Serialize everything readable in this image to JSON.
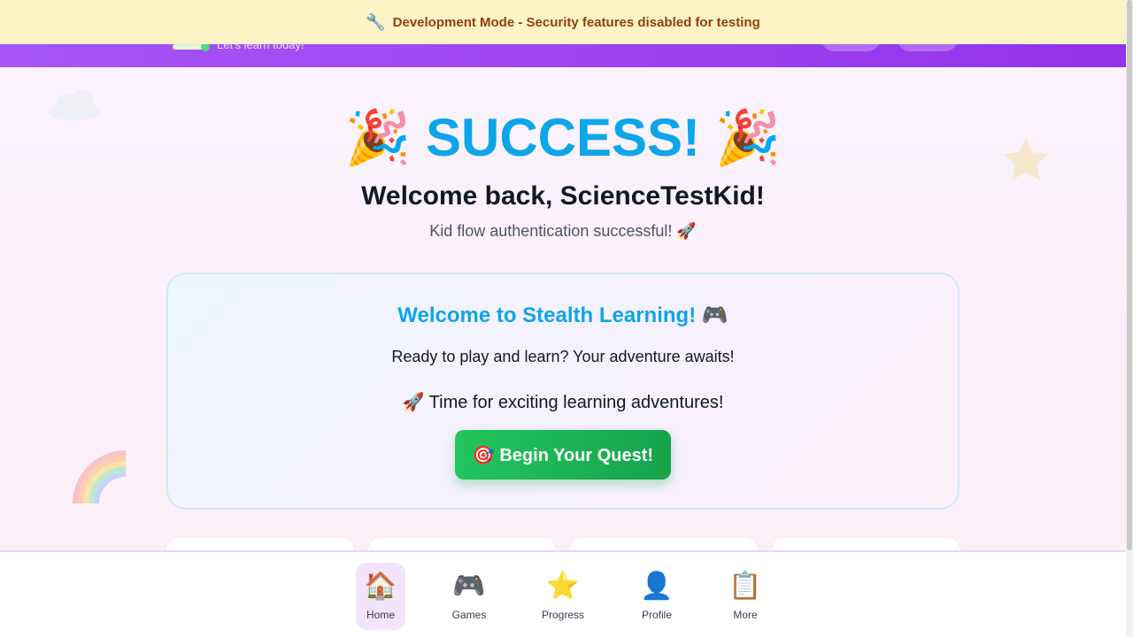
{
  "dev_banner": {
    "icon": "🔧",
    "text": "Development Mode - Security features disabled for testing"
  },
  "header": {
    "tagline": "Let's learn today!"
  },
  "hero": {
    "left_emoji": "🎉",
    "title": "SUCCESS!",
    "right_emoji": "🎉",
    "welcome_back": "Welcome back, ScienceTestKid!",
    "auth_message": "Kid flow authentication successful! 🚀"
  },
  "welcome_card": {
    "title": "Welcome to Stealth Learning! 🎮",
    "subtitle": "Ready to play and learn? Your adventure awaits!",
    "adventure_line": "🚀 Time for exciting learning adventures!",
    "quest_button": "🎯 Begin Your Quest!"
  },
  "bottom_nav": {
    "items": [
      {
        "icon": "🏠",
        "label": "Home",
        "active": true
      },
      {
        "icon": "🎮",
        "label": "Games",
        "active": false
      },
      {
        "icon": "⭐",
        "label": "Progress",
        "active": false
      },
      {
        "icon": "👤",
        "label": "Profile",
        "active": false
      },
      {
        "icon": "📋",
        "label": "More",
        "active": false
      }
    ]
  },
  "colors": {
    "header_purple": "#9333ea",
    "banner_bg": "#fef3c7",
    "banner_text": "#92400e",
    "accent_blue": "#0ea5e9",
    "button_green": "#22c55e"
  }
}
